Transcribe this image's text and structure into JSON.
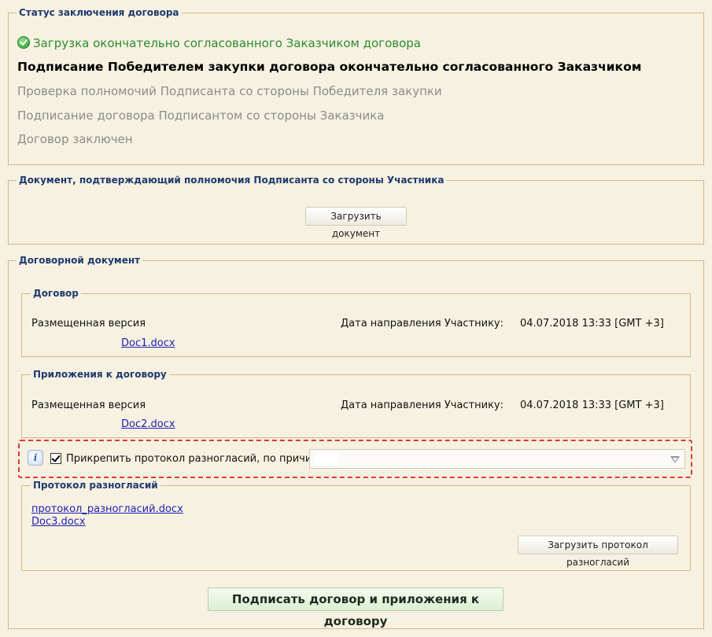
{
  "status_section": {
    "legend": "Статус заключения договора",
    "steps": [
      {
        "label": "Загрузка окончательно согласованного Заказчиком договора",
        "state": "done"
      },
      {
        "label": "Подписание Победителем закупки договора окончательно согласованного Заказчиком",
        "state": "current"
      },
      {
        "label": "Проверка полномочий Подписанта со стороны Победителя закупки",
        "state": "pending"
      },
      {
        "label": "Подписание договора Подписантом со стороны Заказчика",
        "state": "pending"
      },
      {
        "label": "Договор заключен",
        "state": "pending"
      }
    ],
    "done_icon": "check-circle-icon"
  },
  "authority_section": {
    "legend": "Документ, подтверждающий полномочия Подписанта со стороны Участника",
    "upload_button": "Загрузить документ"
  },
  "contract_doc_section": {
    "legend": "Договорной документ",
    "contract": {
      "legend": "Договор",
      "version_label": "Размещенная версия",
      "date_label": "Дата направления Участнику:",
      "date_value": "04.07.2018 13:33 [GMT +3]",
      "file": "Doc1.docx"
    },
    "attachments": {
      "legend": "Приложения к договору",
      "version_label": "Размещенная версия",
      "date_label": "Дата направления Участнику:",
      "date_value": "04.07.2018 13:33 [GMT +3]",
      "file": "Doc2.docx"
    },
    "disagreement_option": {
      "info_icon": "info-icon",
      "checked": true,
      "label": "Прикрепить протокол разногласий, по причине:",
      "reason_value": ""
    },
    "protocol": {
      "legend": "Протокол разногласий",
      "files": [
        "протокол_разногласий.docx",
        "Doc3.docx"
      ],
      "upload_button": "Загрузить протокол разногласий"
    },
    "sign_button": "Подписать договор и приложения к договору"
  },
  "colors": {
    "page_background": "#f6f1e1",
    "border": "#cdb985",
    "legend_text": "#1f3a6e",
    "done_step": "#2e8b2e",
    "pending_step": "#8c8c8c",
    "link": "#1e1eb4",
    "highlight_frame": "#d63a3a"
  }
}
